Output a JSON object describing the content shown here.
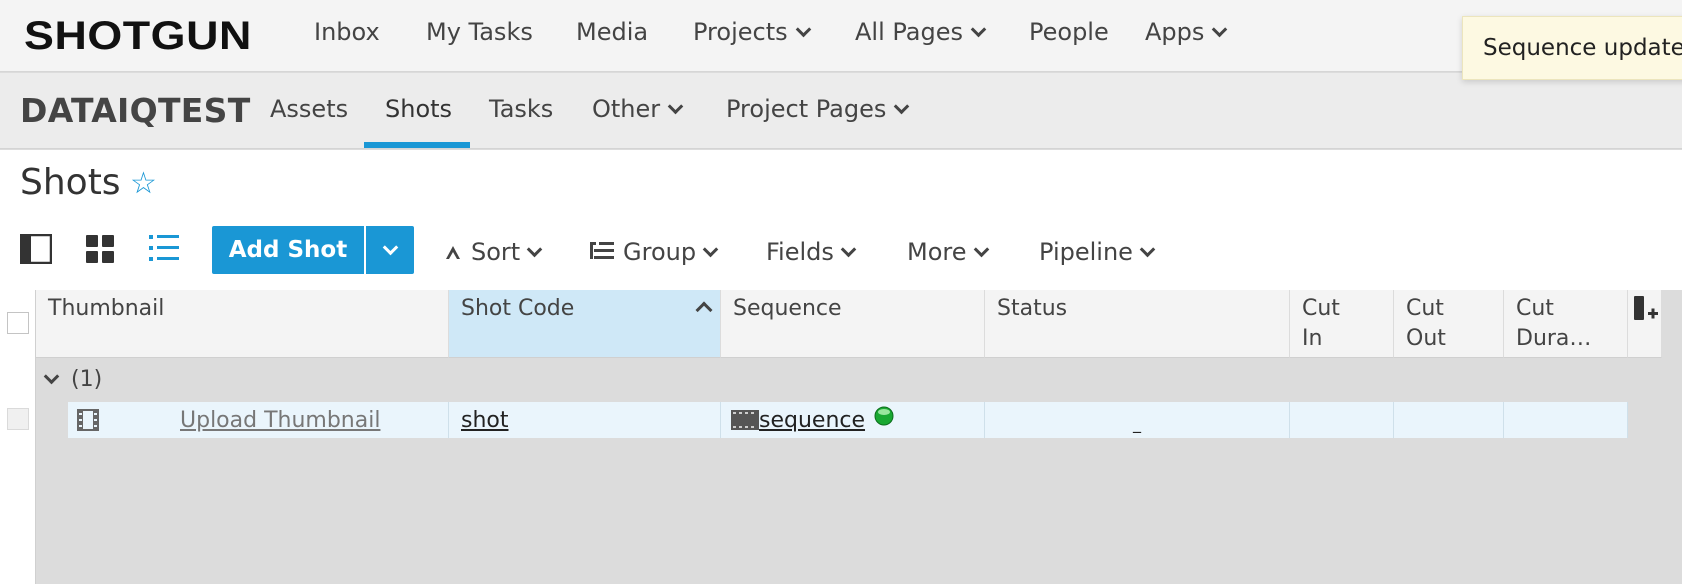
{
  "app": {
    "logo": "SHOTGUN"
  },
  "topnav": {
    "items": [
      {
        "label": "Inbox"
      },
      {
        "label": "My Tasks"
      },
      {
        "label": "Media"
      },
      {
        "label": "Projects"
      },
      {
        "label": "All Pages"
      },
      {
        "label": "People"
      },
      {
        "label": "Apps"
      }
    ]
  },
  "toast": {
    "message": "Sequence updated"
  },
  "project": {
    "name": "DATAIQTEST",
    "tabs": [
      {
        "label": "Assets"
      },
      {
        "label": "Shots",
        "active": true
      },
      {
        "label": "Tasks"
      },
      {
        "label": "Other"
      },
      {
        "label": "Project Pages"
      }
    ]
  },
  "page": {
    "title": "Shots",
    "star_icon": "star-outline-icon"
  },
  "toolbar": {
    "add_label": "Add Shot",
    "sort_label": "Sort",
    "group_label": "Group",
    "fields_label": "Fields",
    "more_label": "More",
    "pipeline_label": "Pipeline"
  },
  "grid": {
    "columns": [
      {
        "label": "Thumbnail"
      },
      {
        "label": "Shot Code",
        "sorted": "ascending"
      },
      {
        "label": "Sequence"
      },
      {
        "label": "Status"
      },
      {
        "label": "Cut In"
      },
      {
        "label": "Cut Out"
      },
      {
        "label": "Cut Dura…"
      }
    ],
    "group": {
      "label": "(1)"
    },
    "rows": [
      {
        "thumbnail": "Upload Thumbnail",
        "shot_code": "shot",
        "sequence": "sequence",
        "status": "_",
        "cut_in": "",
        "cut_out": "",
        "cut_duration": ""
      }
    ]
  },
  "colors": {
    "accent": "#1a97d5",
    "toast_bg": "#fdf9e2",
    "row_bg": "#eaf5fc",
    "sorted_header": "#cfe8f7"
  }
}
